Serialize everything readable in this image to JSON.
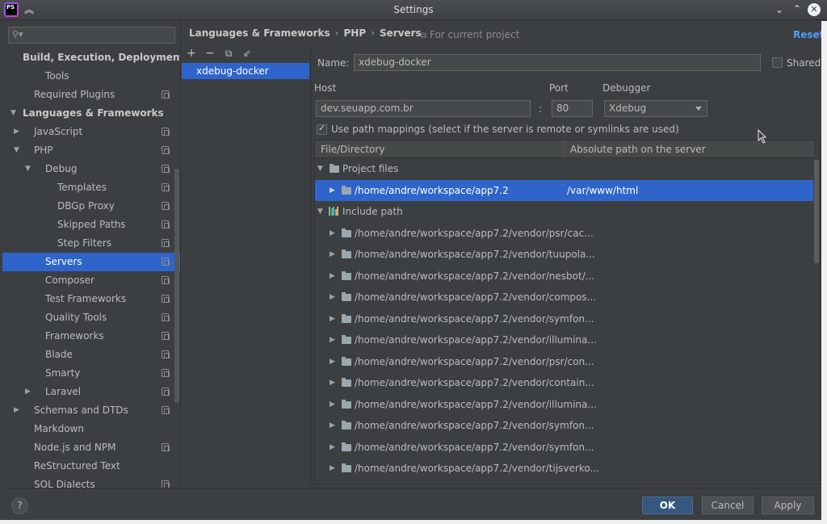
{
  "window": {
    "title": "Settings",
    "app_logo": "PS",
    "controls": {
      "minimize_icon": "chevron-down-icon",
      "maximize_icon": "chevron-up-icon",
      "close_icon": "close-icon",
      "collapse_icon": "double-chevron-up-icon"
    }
  },
  "search": {
    "placeholder": "",
    "value": "",
    "icon": "search-icon"
  },
  "sidebar": {
    "items": [
      {
        "label": "Build, Execution, Deployment",
        "level": 0,
        "bold": true,
        "arrow": "",
        "copy": false
      },
      {
        "label": "Tools",
        "level": 2,
        "bold": false,
        "arrow": "",
        "copy": false
      },
      {
        "label": "Required Plugins",
        "level": 1,
        "bold": false,
        "arrow": "",
        "copy": true
      },
      {
        "label": "Languages & Frameworks",
        "level": 0,
        "bold": true,
        "arrow": "down",
        "copy": false
      },
      {
        "label": "JavaScript",
        "level": 1,
        "bold": false,
        "arrow": "right",
        "copy": true
      },
      {
        "label": "PHP",
        "level": 1,
        "bold": false,
        "arrow": "down",
        "copy": true
      },
      {
        "label": "Debug",
        "level": 2,
        "bold": false,
        "arrow": "down",
        "copy": true
      },
      {
        "label": "Templates",
        "level": 3,
        "bold": false,
        "arrow": "",
        "copy": true
      },
      {
        "label": "DBGp Proxy",
        "level": 3,
        "bold": false,
        "arrow": "",
        "copy": true
      },
      {
        "label": "Skipped Paths",
        "level": 3,
        "bold": false,
        "arrow": "",
        "copy": true
      },
      {
        "label": "Step Filters",
        "level": 3,
        "bold": false,
        "arrow": "",
        "copy": true
      },
      {
        "label": "Servers",
        "level": 2,
        "bold": false,
        "arrow": "",
        "copy": true,
        "selected": true
      },
      {
        "label": "Composer",
        "level": 2,
        "bold": false,
        "arrow": "",
        "copy": true
      },
      {
        "label": "Test Frameworks",
        "level": 2,
        "bold": false,
        "arrow": "",
        "copy": true
      },
      {
        "label": "Quality Tools",
        "level": 2,
        "bold": false,
        "arrow": "",
        "copy": true
      },
      {
        "label": "Frameworks",
        "level": 2,
        "bold": false,
        "arrow": "",
        "copy": true
      },
      {
        "label": "Blade",
        "level": 2,
        "bold": false,
        "arrow": "",
        "copy": true
      },
      {
        "label": "Smarty",
        "level": 2,
        "bold": false,
        "arrow": "",
        "copy": true
      },
      {
        "label": "Laravel",
        "level": 2,
        "bold": false,
        "arrow": "right",
        "copy": true
      },
      {
        "label": "Schemas and DTDs",
        "level": 1,
        "bold": false,
        "arrow": "right",
        "copy": true
      },
      {
        "label": "Markdown",
        "level": 1,
        "bold": false,
        "arrow": "",
        "copy": false
      },
      {
        "label": "Node.js and NPM",
        "level": 1,
        "bold": false,
        "arrow": "",
        "copy": true
      },
      {
        "label": "ReStructured Text",
        "level": 1,
        "bold": false,
        "arrow": "",
        "copy": false
      },
      {
        "label": "SQL Dialects",
        "level": 1,
        "bold": false,
        "arrow": "",
        "copy": true
      }
    ]
  },
  "breadcrumb": {
    "items": [
      "Languages & Frameworks",
      "PHP",
      "Servers"
    ],
    "separator": "›"
  },
  "scope_note": "For current project",
  "reset_label": "Reset",
  "servers_toolbar": {
    "add": "+",
    "remove": "−",
    "copy": "copy-icon",
    "import": "import-icon"
  },
  "servers": [
    "xdebug-docker"
  ],
  "form": {
    "name_label": "Name:",
    "name_value": "xdebug-docker",
    "shared_label": "Shared",
    "shared_checked": false,
    "host_label": "Host",
    "host_value": "dev.seuapp.com.br",
    "port_label": "Port",
    "port_separator": ":",
    "port_value": "80",
    "debugger_label": "Debugger",
    "debugger_value": "Xdebug",
    "path_mappings_label": "Use path mappings (select if the server is remote or symlinks are used)",
    "path_mappings_checked": true
  },
  "mappings": {
    "columns": [
      "File/Directory",
      "Absolute path on the server"
    ],
    "rows": [
      {
        "type": "group",
        "icon": "folder-icon",
        "label": "Project files",
        "expanded": true,
        "server_path": ""
      },
      {
        "type": "child",
        "icon": "folder-icon",
        "label": "/home/andre/workspace/app7.2",
        "server_path": "/var/www/html",
        "selected": true
      },
      {
        "type": "group",
        "icon": "library-icon",
        "label": "Include path",
        "expanded": true,
        "server_path": ""
      },
      {
        "type": "child",
        "icon": "folder-icon",
        "label": "/home/andre/workspace/app7.2/vendor/psr/cac...",
        "server_path": ""
      },
      {
        "type": "child",
        "icon": "folder-icon",
        "label": "/home/andre/workspace/app7.2/vendor/tuupola...",
        "server_path": ""
      },
      {
        "type": "child",
        "icon": "folder-icon",
        "label": "/home/andre/workspace/app7.2/vendor/nesbot/...",
        "server_path": ""
      },
      {
        "type": "child",
        "icon": "folder-icon",
        "label": "/home/andre/workspace/app7.2/vendor/compos...",
        "server_path": ""
      },
      {
        "type": "child",
        "icon": "folder-icon",
        "label": "/home/andre/workspace/app7.2/vendor/symfon...",
        "server_path": ""
      },
      {
        "type": "child",
        "icon": "folder-icon",
        "label": "/home/andre/workspace/app7.2/vendor/illumina...",
        "server_path": ""
      },
      {
        "type": "child",
        "icon": "folder-icon",
        "label": "/home/andre/workspace/app7.2/vendor/psr/con...",
        "server_path": ""
      },
      {
        "type": "child",
        "icon": "folder-icon",
        "label": "/home/andre/workspace/app7.2/vendor/contain...",
        "server_path": ""
      },
      {
        "type": "child",
        "icon": "folder-icon",
        "label": "/home/andre/workspace/app7.2/vendor/illumina...",
        "server_path": ""
      },
      {
        "type": "child",
        "icon": "folder-icon",
        "label": "/home/andre/workspace/app7.2/vendor/symfon...",
        "server_path": ""
      },
      {
        "type": "child",
        "icon": "folder-icon",
        "label": "/home/andre/workspace/app7.2/vendor/symfon...",
        "server_path": ""
      },
      {
        "type": "child",
        "icon": "folder-icon",
        "label": "/home/andre/workspace/app7.2/vendor/tijsverko...",
        "server_path": ""
      }
    ]
  },
  "footer": {
    "help": "?",
    "ok": "OK",
    "cancel": "Cancel",
    "apply": "Apply"
  },
  "colors": {
    "accent": "#2f65ca",
    "link": "#589df6",
    "primary_button": "#365880",
    "background": "#3c3f41"
  }
}
